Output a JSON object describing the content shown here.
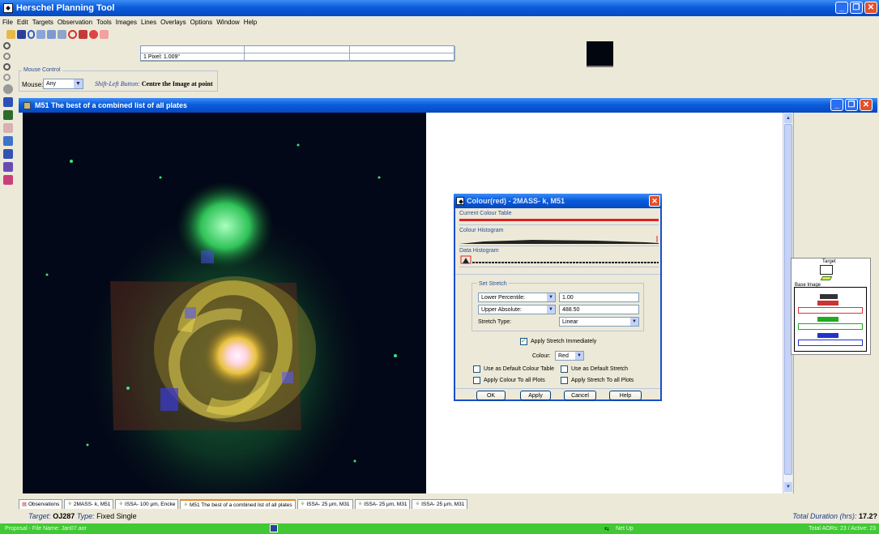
{
  "app": {
    "title": "Herschel Planning Tool"
  },
  "menu": [
    "File",
    "Edit",
    "Targets",
    "Observation",
    "Tools",
    "Images",
    "Lines",
    "Overlays",
    "Options",
    "Window",
    "Help"
  ],
  "pixel_readout": "1 Pixel: 1.009\"",
  "mouse_control": {
    "group_label": "Mouse Control",
    "mouse_label": "Mouse:",
    "mouse_value": "Any",
    "hint_prefix": "Shift-Left Button:",
    "hint_action": "Centre the Image at point"
  },
  "image_window": {
    "title": "M51  The best of a combined list of all plates"
  },
  "dialog": {
    "title": "Colour(red) - 2MASS- k,  M51",
    "current_colour_table": "Current Colour Table",
    "colour_histogram": "Colour Histogram",
    "data_histogram": "Data Histogram",
    "set_stretch": "Set Stretch",
    "lower_combo": "Lower Percentile:",
    "lower_value": "1.00",
    "upper_combo": "Upper Absolute:",
    "upper_value": "488.50",
    "stretch_type_label": "Stretch Type:",
    "stretch_type_value": "Linear",
    "apply_immediately": "Apply Stretch Immediately",
    "colour_label": "Colour:",
    "colour_value": "Red",
    "default_colour_table": "Use as Default Colour Table",
    "default_stretch": "Use as Default Stretch",
    "colour_all": "Apply Colour To all Plots",
    "stretch_all": "Apply Stretch To all Plots",
    "ok": "OK",
    "apply": "Apply",
    "cancel": "Cancel",
    "help": "Help"
  },
  "overlay_panel": {
    "target_label": "Target",
    "base_image_label": "Base Image"
  },
  "tabs": [
    "Observations",
    "2MASS- k,  M51",
    "ISSA- 100 μm,  Encke",
    "M51  The best of a combined list of all plates",
    "ISSA- 25 μm,  M31",
    "ISSA- 25 μm,  M31",
    "ISSA- 25 μm,  M31"
  ],
  "status": {
    "target_prefix": "Target:",
    "target_value": "OJ287",
    "type_prefix": "Type:",
    "type_value": "Fixed Single",
    "duration_prefix": "Total Duration (hrs):",
    "duration_value": "17.2?",
    "proposal": "Proposal - File Name: Jan07.aor",
    "net": "Net Up",
    "aors": "Total AORs: 23  / Active: 23"
  },
  "colors": {
    "titlebar": "#0a5ddc",
    "status_green": "#40c934",
    "galaxy_green": "#23b44a",
    "galaxy_core": "#ffe9f0"
  }
}
